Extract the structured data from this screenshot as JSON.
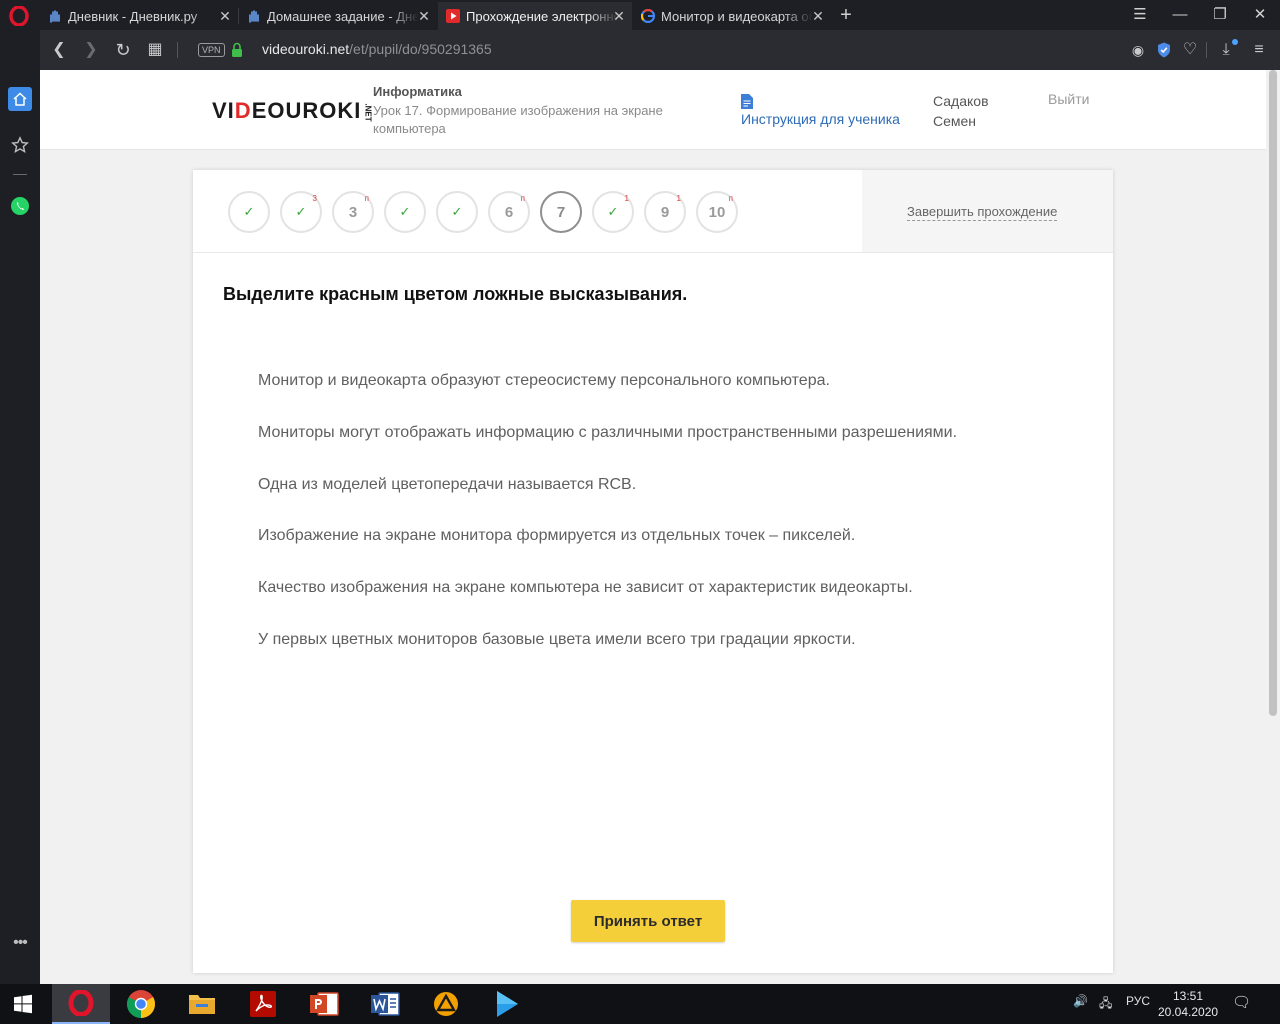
{
  "tabs": [
    {
      "title": "Дневник - Дневник.ру",
      "active": false
    },
    {
      "title": "Домашнее задание - Дневник.ру",
      "active": false
    },
    {
      "title": "Прохождение электронного теста",
      "active": true
    },
    {
      "title": "Монитор и видеокарта образуют",
      "active": false
    }
  ],
  "tab_close_glyph": "✕",
  "new_tab_glyph": "+",
  "window_controls": {
    "minimize": "—",
    "restore": "❐",
    "close": "✕",
    "easy_setup": "☰"
  },
  "address": {
    "vpn": "VPN",
    "host": "videouroki.net",
    "path": "/et/pupil/do/950291365"
  },
  "nav": {
    "back": "❮",
    "forward": "❯",
    "reload": "↻",
    "tabs": "▦"
  },
  "toolbar": {
    "snapshot": "◉",
    "heart": "♡",
    "download": "⤓",
    "menu": "≡"
  },
  "site": {
    "logo_pre": "VI",
    "logo_accent": "D",
    "logo_post": "EOUROKI",
    "logo_tld": ".NET",
    "subject": "Информатика",
    "lesson": "Урок 17. Формирование изображения на экране компьютера",
    "instruction": "Инструкция для ученика",
    "user_first": "Садаков",
    "user_last": "Семен",
    "logout": "Выйти"
  },
  "steps": [
    {
      "label": "✓",
      "mark": "",
      "state": "done"
    },
    {
      "label": "✓",
      "mark": "3",
      "state": "done"
    },
    {
      "label": "3",
      "mark": "п",
      "state": "todo"
    },
    {
      "label": "✓",
      "mark": "",
      "state": "done"
    },
    {
      "label": "✓",
      "mark": "",
      "state": "done"
    },
    {
      "label": "6",
      "mark": "п",
      "state": "todo"
    },
    {
      "label": "7",
      "mark": "",
      "state": "current"
    },
    {
      "label": "✓",
      "mark": "1",
      "state": "done"
    },
    {
      "label": "9",
      "mark": "1",
      "state": "todo"
    },
    {
      "label": "10",
      "mark": "п",
      "state": "todo"
    }
  ],
  "finish": "Завершить прохождение",
  "question": "Выделите красным цветом ложные высказывания.",
  "statements": [
    "Монитор и видеокарта образуют стереосистему персонального компьютера.",
    "Мониторы могут отображать информацию с различными пространственными разрешениями.",
    "Одна из моделей цветопередачи называется RCB.",
    "Изображение на экране монитора формируется из отдельных точек – пикселей.",
    "Качество изображения на экране компьютера не зависит от характеристик видеокарты.",
    "У первых цветных мониторов базовые цвета имели всего три градации яркости."
  ],
  "submit": "Принять ответ",
  "taskbar": {
    "volume": "🔊",
    "network": "🖧",
    "lang": "РУС",
    "time": "13:51",
    "date": "20.04.2020",
    "notifications": "🗨"
  },
  "colors": {
    "accent_yellow": "#f5cf3a",
    "link_blue": "#2d6bb5",
    "check_green": "#3aa53a",
    "mark_red": "#e03a3a",
    "opera_red": "#e0152b"
  }
}
